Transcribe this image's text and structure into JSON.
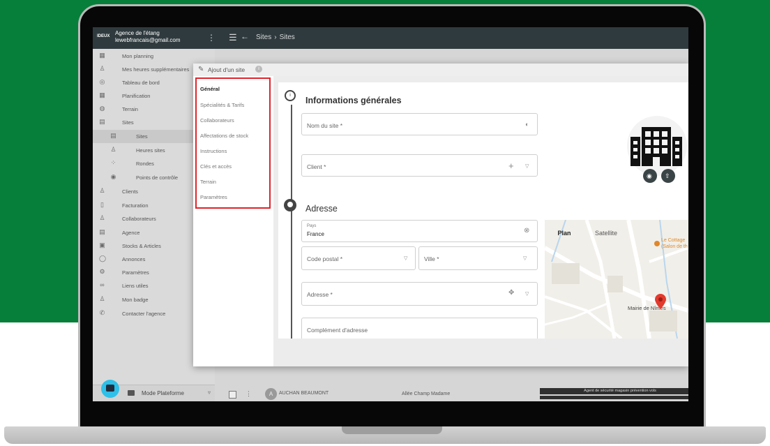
{
  "app": {
    "brand": "IDEUX",
    "agency_name": "Agence de l'étang",
    "agency_email": "lewebfrancais@gmail.com",
    "breadcrumb": [
      "Sites",
      "Sites"
    ]
  },
  "sidebar": {
    "items": [
      {
        "label": "Mon planning",
        "icon": "calendar-icon"
      },
      {
        "label": "Mes heures supplémentaires",
        "icon": "user-clock-icon"
      },
      {
        "label": "Tableau de bord",
        "icon": "dashboard-icon"
      },
      {
        "label": "Planification",
        "icon": "calendar-icon"
      },
      {
        "label": "Terrain",
        "icon": "globe-icon"
      },
      {
        "label": "Sites",
        "icon": "building-icon"
      },
      {
        "label": "Sites",
        "icon": "building-icon",
        "sub": true,
        "active": true
      },
      {
        "label": "Heures sites",
        "icon": "user-clock-icon",
        "sub": true
      },
      {
        "label": "Rondes",
        "icon": "route-icon",
        "sub": true
      },
      {
        "label": "Points de contrôle",
        "icon": "pin-icon",
        "sub": true
      },
      {
        "label": "Clients",
        "icon": "user-icon"
      },
      {
        "label": "Facturation",
        "icon": "invoice-icon"
      },
      {
        "label": "Collaborateurs",
        "icon": "user-icon"
      },
      {
        "label": "Agence",
        "icon": "building-icon"
      },
      {
        "label": "Stocks & Articles",
        "icon": "boxes-icon"
      },
      {
        "label": "Annonces",
        "icon": "chat-icon"
      },
      {
        "label": "Paramètres",
        "icon": "gears-icon"
      },
      {
        "label": "Liens utiles",
        "icon": "link-icon"
      },
      {
        "label": "Mon badge",
        "icon": "badge-icon"
      },
      {
        "label": "Contacter l'agence",
        "icon": "phone-icon"
      }
    ],
    "mode_label": "Mode Plateforme"
  },
  "background_row": {
    "avatar_letter": "A",
    "name": "AUCHAN BEAUMONT",
    "address": "Allée Champ Madame",
    "tag": "Agent de sécurité magasin prévention vols"
  },
  "modal": {
    "title": "Ajout d'un site",
    "nav": [
      "Général",
      "Spécialités & Tarifs",
      "Collaborateurs",
      "Affectations de stock",
      "Instructions",
      "Clés et accès",
      "Terrain",
      "Paramètres"
    ],
    "section_general": "Informations générales",
    "section_address": "Adresse",
    "fields": {
      "site_name": "Nom du site *",
      "client": "Client *",
      "country_label": "Pays",
      "country_value": "France",
      "postal_code": "Code postal *",
      "city": "Ville *",
      "address": "Adresse *",
      "address_complement": "Complément d'adresse"
    },
    "map": {
      "plan": "Plan",
      "satellite": "Satellite",
      "place_line1": "Le Cottage",
      "place_line2": "(Salon de th",
      "mairie": "Mairie de Nîmes"
    }
  }
}
